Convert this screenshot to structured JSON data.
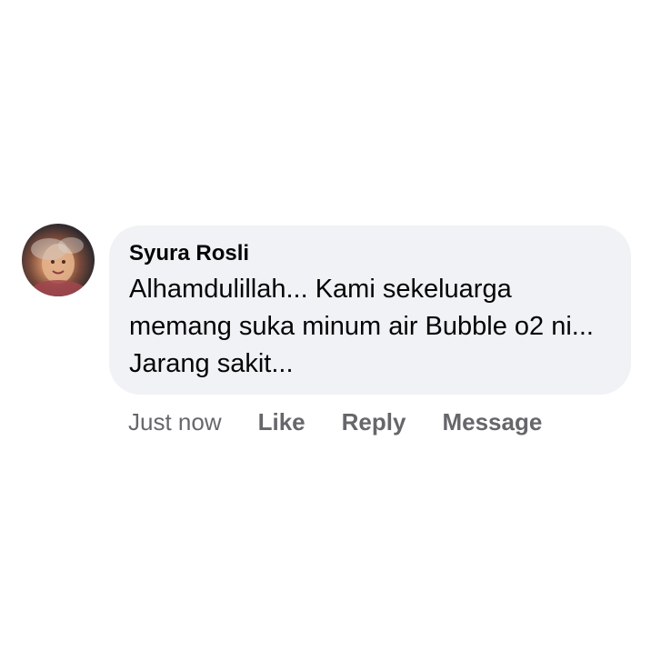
{
  "comment": {
    "author": "Syura Rosli",
    "text": "Alhamdulillah... Kami sekeluarga memang suka minum air Bubble o2 ni... Jarang sakit...",
    "timestamp": "Just now",
    "actions": {
      "like": "Like",
      "reply": "Reply",
      "message": "Message"
    }
  },
  "colors": {
    "bubble_background": "#f0f2f5",
    "primary_text": "#050505",
    "secondary_text": "#65676b"
  },
  "icons": {
    "avatar": "profile-photo"
  }
}
